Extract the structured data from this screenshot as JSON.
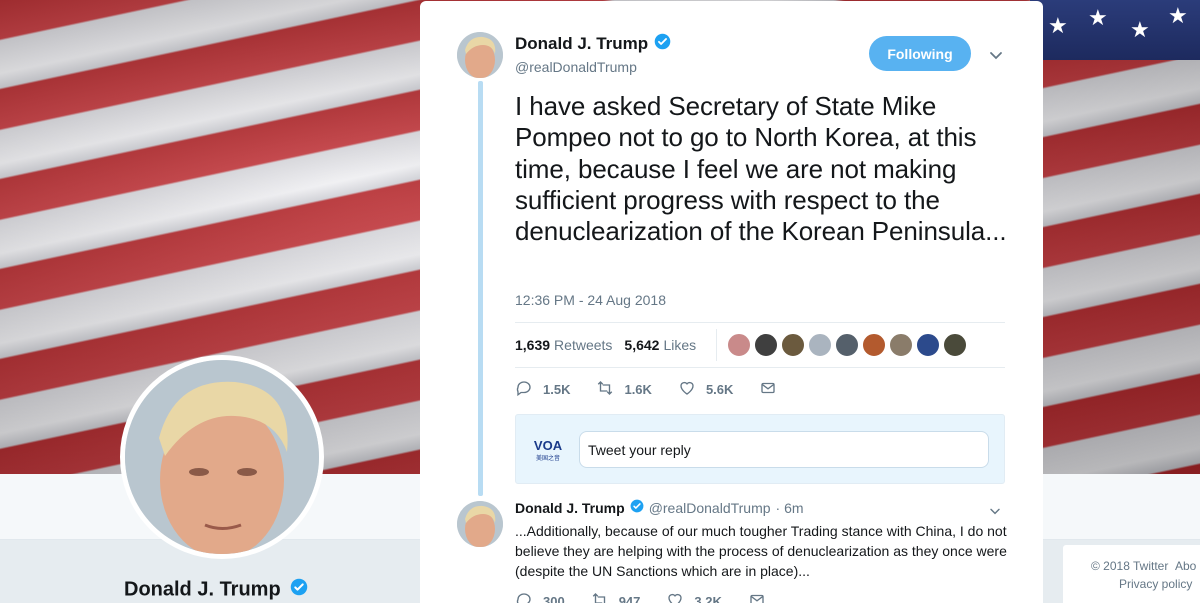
{
  "profile": {
    "name": "Donald J. Trump"
  },
  "footer": {
    "copyright": "© 2018 Twitter",
    "about": "Abo",
    "privacy": "Privacy policy"
  },
  "tweet": {
    "author_name": "Donald J. Trump",
    "author_handle": "@realDonaldTrump",
    "follow_label": "Following",
    "text": "I have asked Secretary of State Mike Pompeo not to go to North Korea, at this time, because I feel we are not making sufficient progress with respect to the denuclearization of the Korean Peninsula...",
    "timestamp": "12:36 PM - 24 Aug 2018",
    "retweets_count": "1,639",
    "retweets_label": "Retweets",
    "likes_count": "5,642",
    "likes_label": "Likes",
    "reply_count": "1.5K",
    "retweet_action_count": "1.6K",
    "like_action_count": "5.6K"
  },
  "reply_composer": {
    "placeholder": "Tweet your reply",
    "logo_text": "VOA",
    "logo_subtext": "美国之音"
  },
  "reply_tweet": {
    "author_name": "Donald J. Trump",
    "author_handle": "@realDonaldTrump",
    "age": "· 6m",
    "text": "...Additionally, because of our much tougher Trading stance with China, I do not believe they are helping with the process of denuclearization as they once were (despite the UN Sanctions which are in place)...",
    "reply_count": "300",
    "retweet_count": "947",
    "like_count": "3.2K"
  },
  "colors": {
    "accent": "#1da1f2",
    "follow_button": "#58b2f1",
    "thread_line": "#b8dcf3",
    "muted_text": "#657786"
  },
  "likers": [
    {
      "name": "liker-1",
      "color": "#c98a8a"
    },
    {
      "name": "liker-2",
      "color": "#3f3f3f"
    },
    {
      "name": "liker-3",
      "color": "#6b5a3e"
    },
    {
      "name": "liker-4",
      "color": "#aab4bf"
    },
    {
      "name": "liker-5",
      "color": "#55606b"
    },
    {
      "name": "liker-6",
      "color": "#b35a2e"
    },
    {
      "name": "liker-7",
      "color": "#8a7c6a"
    },
    {
      "name": "liker-8",
      "color": "#2c4a8c"
    },
    {
      "name": "liker-9",
      "color": "#4a4a3a"
    }
  ]
}
